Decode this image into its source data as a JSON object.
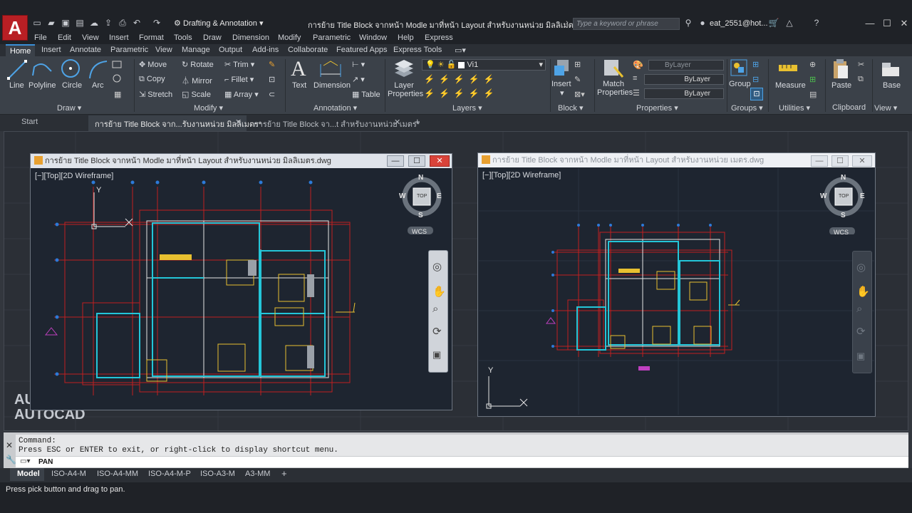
{
  "app": {
    "logo_letter": "A"
  },
  "title_bar": {
    "workspace": "Drafting & Annotation",
    "document_title": "การย้าย Title Block จากหน้า Modle มาที่หน้า Layout สำหรับงานหน่วย มิลลิเมตร.dwg",
    "search_placeholder": "Type a keyword or phrase",
    "user": "eat_2551@hot..."
  },
  "menu": [
    "File",
    "Edit",
    "View",
    "Insert",
    "Format",
    "Tools",
    "Draw",
    "Dimension",
    "Modify",
    "Parametric",
    "Window",
    "Help",
    "Express"
  ],
  "ribbon_tabs": [
    "Home",
    "Insert",
    "Annotate",
    "Parametric",
    "View",
    "Manage",
    "Output",
    "Add-ins",
    "Collaborate",
    "Featured Apps",
    "Express Tools"
  ],
  "ribbon": {
    "draw": {
      "title": "Draw",
      "line": "Line",
      "polyline": "Polyline",
      "circle": "Circle",
      "arc": "Arc"
    },
    "modify": {
      "title": "Modify",
      "move": "Move",
      "rotate": "Rotate",
      "trim": "Trim",
      "copy": "Copy",
      "mirror": "Mirror",
      "fillet": "Fillet",
      "stretch": "Stretch",
      "scale": "Scale",
      "array": "Array"
    },
    "annotation": {
      "title": "Annotation",
      "text": "Text",
      "dimension": "Dimension",
      "table": "Table"
    },
    "layers": {
      "title": "Layers",
      "layer_properties": "Layer Properties",
      "current_layer": "Vi1"
    },
    "block": {
      "title": "Block",
      "insert": "Insert"
    },
    "properties": {
      "title": "Properties",
      "match": "Match Properties",
      "color": "ByLayer",
      "linetype": "ByLayer",
      "lineweight": "ByLayer"
    },
    "groups": {
      "title": "Groups",
      "group": "Group"
    },
    "utilities": {
      "title": "Utilities",
      "measure": "Measure"
    },
    "clipboard": {
      "title": "Clipboard",
      "paste": "Paste"
    },
    "view": {
      "title": "View",
      "base": "Base"
    }
  },
  "doc_tabs": [
    "Start",
    "การย้าย Title Block จาก...รับงานหน่วย มิลลิเมตร*",
    "การย้าย Title Block จา...t สำหรับงานหน่วย เมตร*"
  ],
  "viewports": {
    "left": {
      "title": "การย้าย Title Block จากหน้า Modle มาที่หน้า Layout สำหรับงานหน่วย มิลลิเมตร.dwg",
      "label": "[−][Top][2D Wireframe]"
    },
    "right": {
      "title": "การย้าย Title Block จากหน้า Modle มาที่หน้า Layout สำหรับงานหน่วย เมตร.dwg",
      "label": "[−][Top][2D Wireframe]"
    }
  },
  "viewcube": {
    "n": "N",
    "s": "S",
    "e": "E",
    "w": "W",
    "top": "TOP",
    "wcs": "WCS"
  },
  "watermark": {
    "line1": "AU",
    "line2": "AUTOCAD"
  },
  "command": {
    "history1": "Command:",
    "history2": "Press ESC or ENTER to exit, or right-click to display shortcut menu.",
    "current": "PAN"
  },
  "layout_tabs": [
    "Model",
    "ISO-A4-M",
    "ISO-A4-MM",
    "ISO-A4-M-P",
    "ISO-A3-M",
    "A3-MM"
  ],
  "status": "Press pick button and drag to pan."
}
